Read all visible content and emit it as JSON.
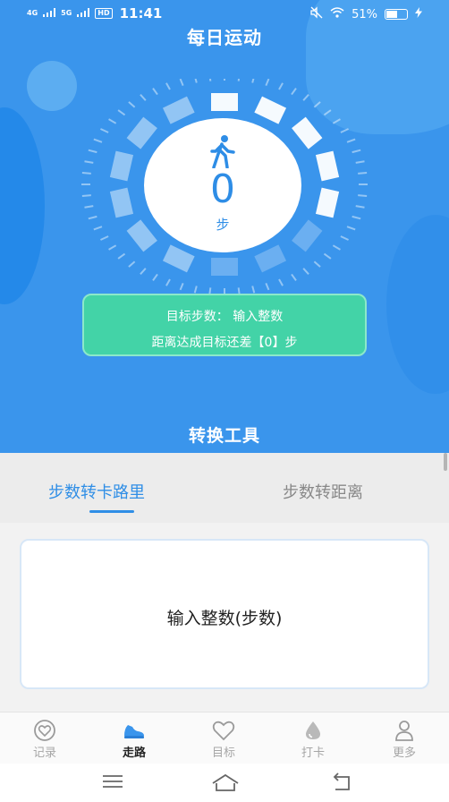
{
  "status_bar": {
    "signal1": "4G",
    "signal2": "5G",
    "hd": "HD",
    "time": "11:41",
    "battery": "51%",
    "battery_level": 0.51
  },
  "page_title": "每日运动",
  "dial": {
    "walker_icon": "walking-person-icon",
    "steps": "0",
    "unit": "步"
  },
  "goal": {
    "line1": "目标步数： 输入整数",
    "line2": "距离达成目标还差【0】步"
  },
  "tool_title": "转换工具",
  "tabs": [
    {
      "label": "步数转卡路里",
      "active": true
    },
    {
      "label": "步数转距离",
      "active": false
    }
  ],
  "input": {
    "placeholder": "输入整数(步数)"
  },
  "bottom_nav": [
    {
      "label": "记录",
      "icon": "heart-record-icon",
      "active": false
    },
    {
      "label": "走路",
      "icon": "shoe-icon",
      "active": true
    },
    {
      "label": "目标",
      "icon": "heart-icon",
      "active": false
    },
    {
      "label": "打卡",
      "icon": "drop-icon",
      "active": false
    },
    {
      "label": "更多",
      "icon": "person-icon",
      "active": false
    }
  ],
  "colors": {
    "primary": "#3a95ec",
    "accent_green": "#43d3a7",
    "tab_active": "#2f8ee6"
  }
}
